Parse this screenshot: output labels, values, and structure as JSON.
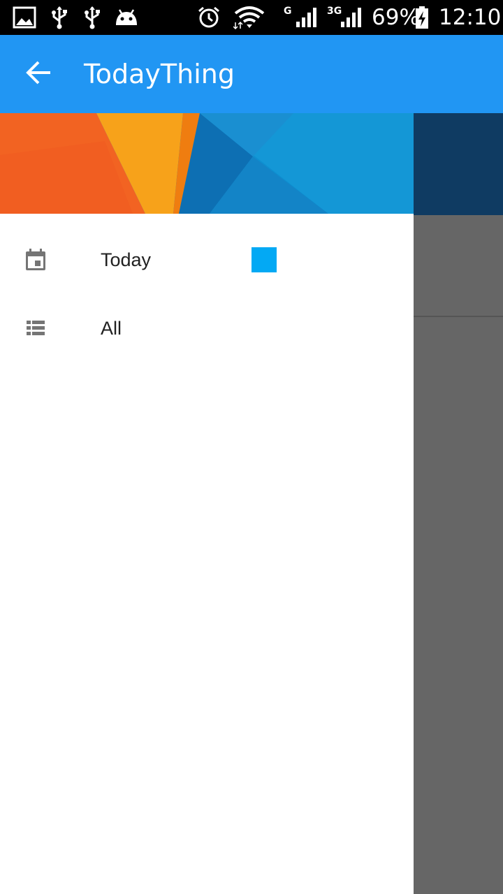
{
  "status_bar": {
    "battery_percent": "69%",
    "time": "12:10",
    "network_type_1": "G",
    "network_type_2": "3G",
    "icons": [
      "image-icon",
      "usb-icon",
      "usb-icon",
      "android-icon",
      "alarm-icon",
      "wifi-icon",
      "signal-icon",
      "signal-icon",
      "battery-charging-icon"
    ]
  },
  "app_bar": {
    "title": "TodayThing",
    "back_icon": "arrow-back-icon",
    "color": "#2196f3"
  },
  "drawer": {
    "items": [
      {
        "label": "Today",
        "icon": "calendar-icon",
        "badge_color": "#03a9f4"
      },
      {
        "label": "All",
        "icon": "list-icon"
      }
    ]
  }
}
